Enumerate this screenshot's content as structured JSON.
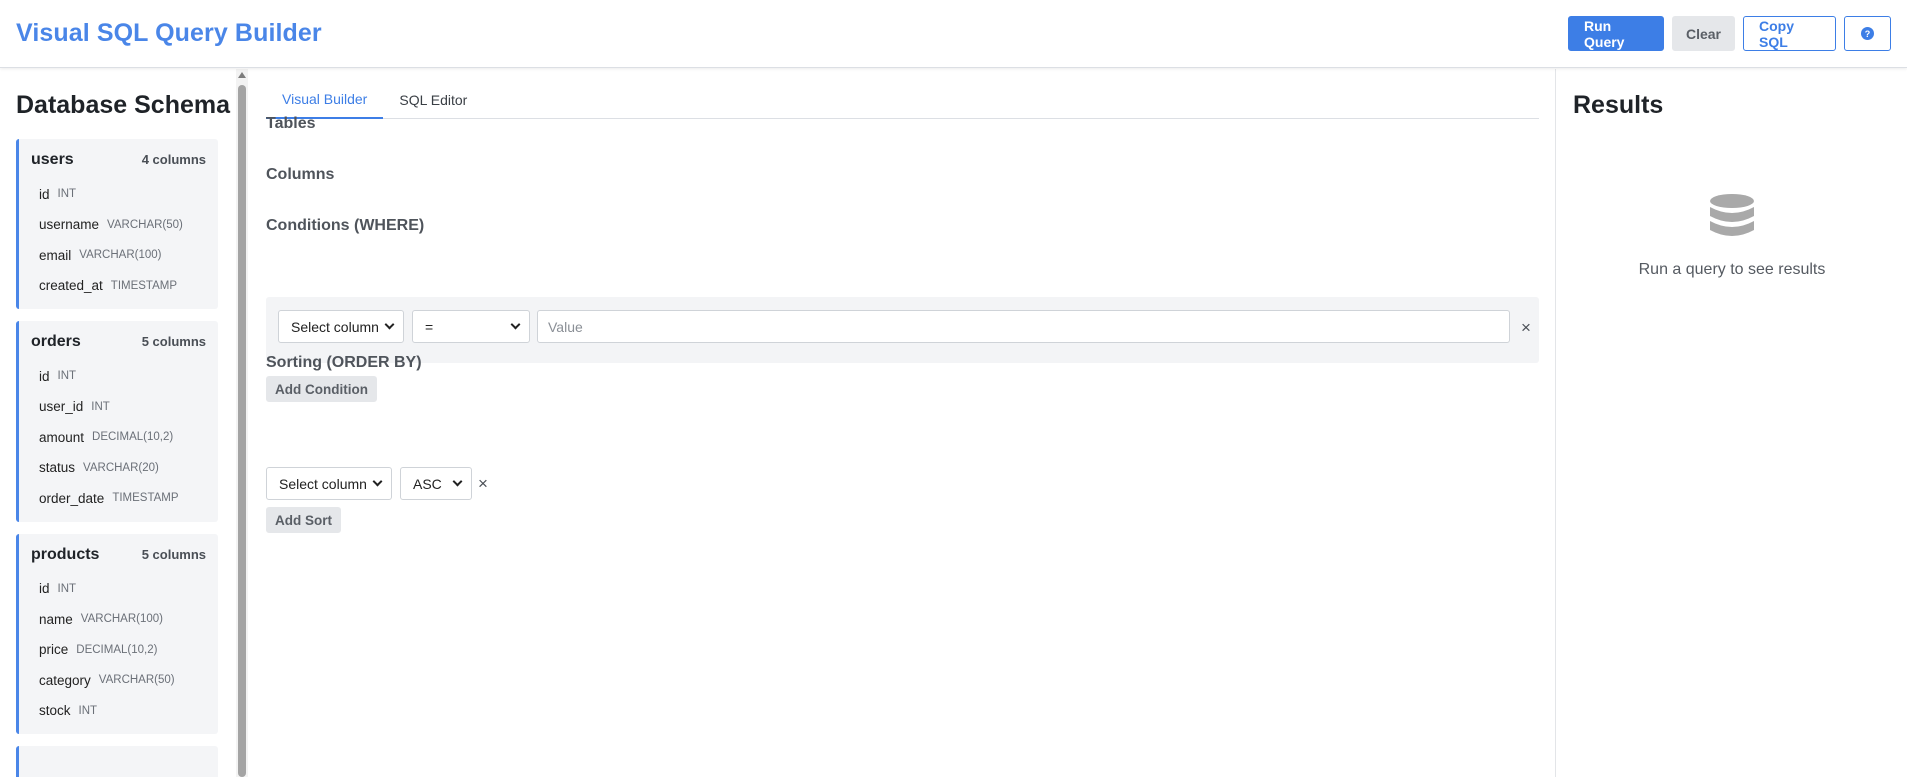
{
  "header": {
    "title": "Visual SQL Query Builder",
    "actions": {
      "run": "Run Query",
      "clear": "Clear",
      "copy": "Copy SQL",
      "help": "?"
    }
  },
  "sidebar": {
    "title": "Database Schema",
    "tables": [
      {
        "name": "users",
        "count": "4 columns",
        "columns": [
          {
            "name": "id",
            "type": "INT"
          },
          {
            "name": "username",
            "type": "VARCHAR(50)"
          },
          {
            "name": "email",
            "type": "VARCHAR(100)"
          },
          {
            "name": "created_at",
            "type": "TIMESTAMP"
          }
        ]
      },
      {
        "name": "orders",
        "count": "5 columns",
        "columns": [
          {
            "name": "id",
            "type": "INT"
          },
          {
            "name": "user_id",
            "type": "INT"
          },
          {
            "name": "amount",
            "type": "DECIMAL(10,2)"
          },
          {
            "name": "status",
            "type": "VARCHAR(20)"
          },
          {
            "name": "order_date",
            "type": "TIMESTAMP"
          }
        ]
      },
      {
        "name": "products",
        "count": "5 columns",
        "columns": [
          {
            "name": "id",
            "type": "INT"
          },
          {
            "name": "name",
            "type": "VARCHAR(100)"
          },
          {
            "name": "price",
            "type": "DECIMAL(10,2)"
          },
          {
            "name": "category",
            "type": "VARCHAR(50)"
          },
          {
            "name": "stock",
            "type": "INT"
          }
        ]
      }
    ]
  },
  "main": {
    "tabs": [
      {
        "label": "Visual Builder",
        "active": true
      },
      {
        "label": "SQL Editor",
        "active": false
      }
    ],
    "sections": {
      "tables": "Tables",
      "columns": "Columns",
      "conditions": "Conditions (WHERE)",
      "sorting": "Sorting (ORDER BY)"
    },
    "condition": {
      "column": "Select column",
      "operator": "=",
      "value_placeholder": "Value",
      "remove": "×"
    },
    "add_condition": "Add Condition",
    "sort": {
      "column": "Select column",
      "direction": "ASC",
      "remove": "×"
    },
    "add_sort": "Add Sort"
  },
  "results": {
    "title": "Results",
    "empty_text": "Run a query to see results",
    "icon": "database-icon"
  },
  "colors": {
    "accent": "#3d7ee6",
    "title": "#4a86e8"
  }
}
